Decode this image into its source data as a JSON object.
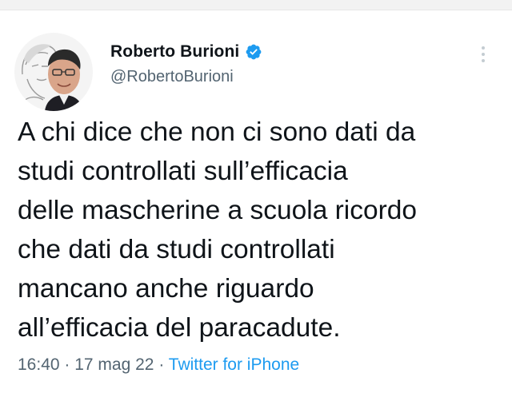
{
  "tweet": {
    "author": {
      "display_name": "Roberto Burioni",
      "handle": "@RobertoBurioni",
      "verified": true,
      "avatar_icon": "profile-photo-icon"
    },
    "text_lines": [
      "A chi dice che non ci sono dati da",
      "studi controllati  sull’efficacia",
      "delle mascherine a scuola ricordo",
      "che dati da studi controllati",
      "mancano anche riguardo",
      "all’efficacia del paracadute."
    ],
    "time": "16:40",
    "separator": "·",
    "date": "17 mag 22",
    "source": "Twitter for iPhone"
  },
  "icons": {
    "verified": "verified-badge-icon",
    "more": "more-options-icon"
  },
  "colors": {
    "text_primary": "#0f1419",
    "text_secondary": "#536471",
    "link": "#1d9bf0",
    "verified": "#1d9bf0"
  }
}
